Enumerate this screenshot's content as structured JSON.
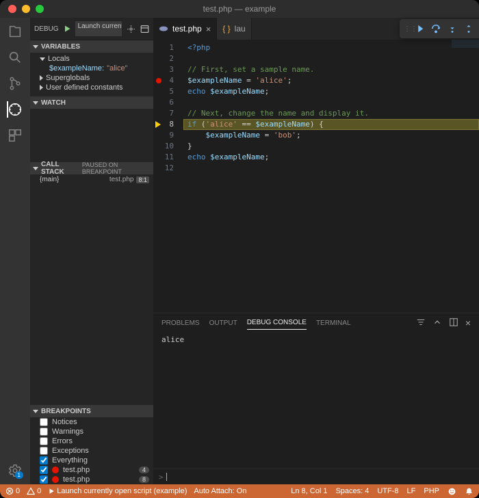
{
  "window": {
    "title": "test.php — example"
  },
  "sidebar": {
    "debugLabel": "DEBUG",
    "config": "Launch currently op",
    "sections": {
      "variables": {
        "title": "VARIABLES",
        "locals": "Locals",
        "superglobals": "Superglobals",
        "userconst": "User defined constants",
        "varName": "$exampleName:",
        "varVal": "\"alice\""
      },
      "watch": {
        "title": "WATCH"
      },
      "callstack": {
        "title": "CALL STACK",
        "status": "PAUSED ON BREAKPOINT",
        "frame": "{main}",
        "file": "test.php",
        "line": "8:1"
      },
      "breakpoints": {
        "title": "BREAKPOINTS",
        "items": [
          {
            "label": "Notices",
            "checked": false,
            "kind": "cat"
          },
          {
            "label": "Warnings",
            "checked": false,
            "kind": "cat"
          },
          {
            "label": "Errors",
            "checked": false,
            "kind": "cat"
          },
          {
            "label": "Exceptions",
            "checked": false,
            "kind": "cat"
          },
          {
            "label": "Everything",
            "checked": true,
            "kind": "cat"
          },
          {
            "label": "test.php",
            "checked": true,
            "kind": "bp",
            "count": "4"
          },
          {
            "label": "test.php",
            "checked": true,
            "kind": "bp",
            "count": "8"
          }
        ]
      }
    }
  },
  "tabs": {
    "active": "test.php",
    "inactive": "lau"
  },
  "code": {
    "lines": [
      {
        "n": 1,
        "tokens": [
          [
            "kw",
            "<?php"
          ]
        ]
      },
      {
        "n": 2,
        "tokens": []
      },
      {
        "n": 3,
        "tokens": [
          [
            "com",
            "// First, set a sample name."
          ]
        ]
      },
      {
        "n": 4,
        "bp": true,
        "tokens": [
          [
            "var",
            "$exampleName"
          ],
          [
            "pl",
            " = "
          ],
          [
            "str",
            "'alice'"
          ],
          [
            "pl",
            ";"
          ]
        ]
      },
      {
        "n": 5,
        "tokens": [
          [
            "kw",
            "echo"
          ],
          [
            "pl",
            " "
          ],
          [
            "var",
            "$exampleName"
          ],
          [
            "pl",
            ";"
          ]
        ]
      },
      {
        "n": 6,
        "tokens": []
      },
      {
        "n": 7,
        "tokens": [
          [
            "com",
            "// Next, change the name and display it."
          ]
        ]
      },
      {
        "n": 8,
        "cur": true,
        "hl": true,
        "tokens": [
          [
            "kw",
            "if"
          ],
          [
            "pl",
            " ("
          ],
          [
            "str",
            "'alice'"
          ],
          [
            "pl",
            " == "
          ],
          [
            "var",
            "$exampleName"
          ],
          [
            "pl",
            ") {"
          ]
        ]
      },
      {
        "n": 9,
        "tokens": [
          [
            "pl",
            "    "
          ],
          [
            "var",
            "$exampleName"
          ],
          [
            "pl",
            " = "
          ],
          [
            "str",
            "'bob'"
          ],
          [
            "pl",
            ";"
          ]
        ]
      },
      {
        "n": 10,
        "tokens": [
          [
            "pl",
            "}"
          ]
        ]
      },
      {
        "n": 11,
        "tokens": [
          [
            "kw",
            "echo"
          ],
          [
            "pl",
            " "
          ],
          [
            "var",
            "$exampleName"
          ],
          [
            "pl",
            ";"
          ]
        ]
      },
      {
        "n": 12,
        "tokens": []
      }
    ]
  },
  "panel": {
    "tabs": [
      "PROBLEMS",
      "OUTPUT",
      "DEBUG CONSOLE",
      "TERMINAL"
    ],
    "active": 2,
    "consoleOut": "alice",
    "prompt": ">"
  },
  "status": {
    "errors": "0",
    "warnings": "0",
    "launch": "Launch currently open script (example)",
    "autoattach": "Auto Attach: On",
    "pos": "Ln 8, Col 1",
    "spaces": "Spaces: 4",
    "enc": "UTF-8",
    "eol": "LF",
    "lang": "PHP"
  }
}
